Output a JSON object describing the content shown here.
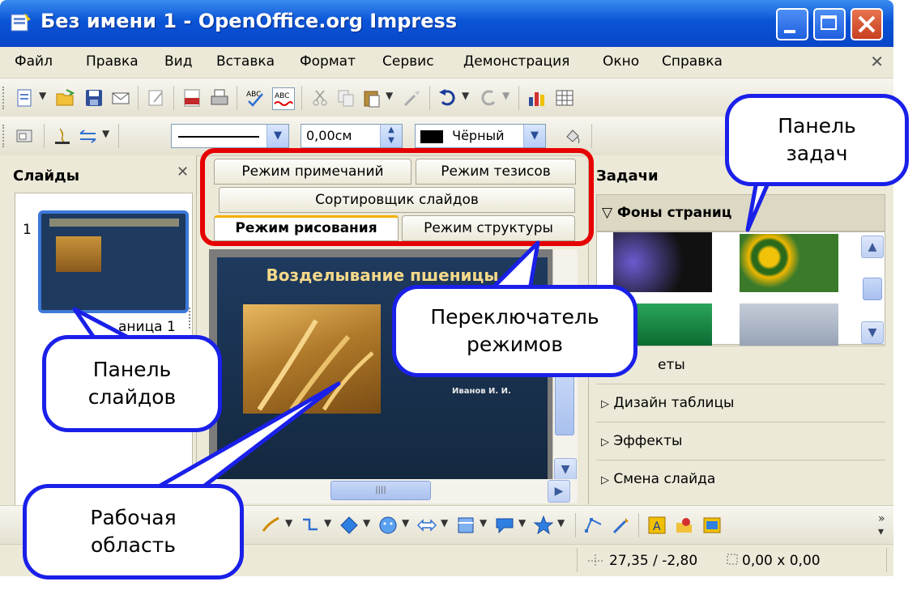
{
  "window": {
    "title": "Без имени 1 - OpenOffice.org Impress"
  },
  "menu": [
    "Файл",
    "Правка",
    "Вид",
    "Вставка",
    "Формат",
    "Сервис",
    "Демонстрация",
    "Окно",
    "Справка"
  ],
  "format_toolbar": {
    "width_value": "0,00см",
    "color_name": "Чёрный"
  },
  "slides_panel": {
    "title": "Слайды",
    "slide_number": "1",
    "slide_label_partial": "аница 1"
  },
  "view_tabs": {
    "notes": "Режим примечаний",
    "handout": "Режим тезисов",
    "sorter": "Сортировщик слайдов",
    "drawing": "Режим рисования",
    "outline": "Режим структуры"
  },
  "slide": {
    "title": "Возделывание пшеницы",
    "author": "Иванов И. И."
  },
  "tasks_panel": {
    "title": "Задачи",
    "sections": [
      "Фоны страниц",
      "Макеты",
      "Дизайн таблицы",
      "Эффекты",
      "Смена слайда"
    ],
    "layouts_partial": "еты"
  },
  "status": {
    "position": "27,35 / -2,80",
    "size": "0,00 x 0,00"
  },
  "callouts": {
    "tasks": "Панель задач",
    "switcher": "Переключатель режимов",
    "slides": "Панель слайдов",
    "work": "Рабочая область"
  },
  "colors": {
    "callout_border": "#1a20e8",
    "highlight_frame": "#e60000",
    "title_bar": "#0a54d6"
  }
}
